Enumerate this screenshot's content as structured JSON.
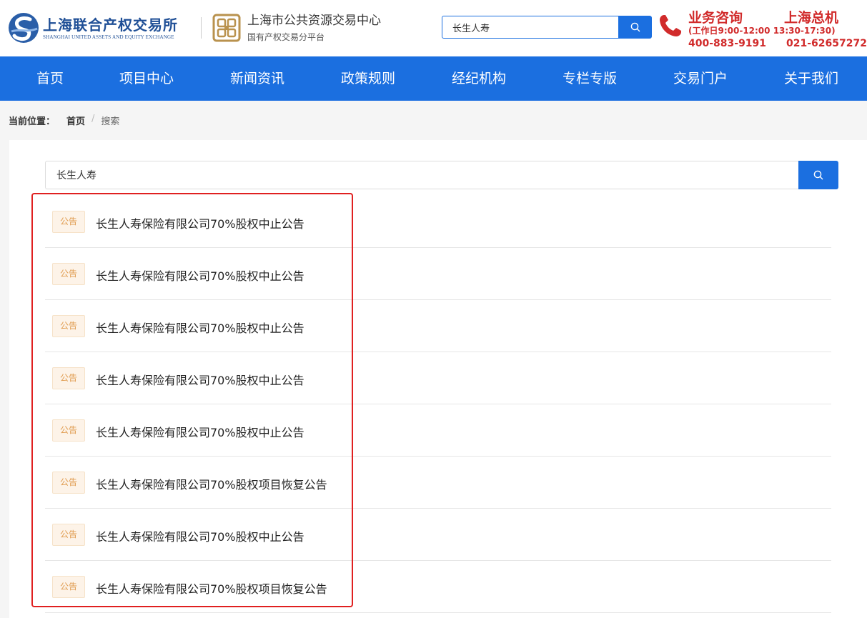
{
  "header": {
    "logo1": {
      "cn": "上海联合产权交易所",
      "en": "SHANGHAI UNITED ASSETS AND EQUITY EXCHANGE"
    },
    "logo2": {
      "cn": "上海市公共资源交易中心",
      "sub": "国有产权交易分平台"
    },
    "search": {
      "value": "长生人寿",
      "icon": "search-icon"
    },
    "contact": {
      "title1": "业务咨询",
      "title2": "上海总机",
      "hours": "(工作日9:00-12:00 13:30-17:30)",
      "phone1": "400-883-9191",
      "phone2": "021-62657272",
      "icon": "phone-icon"
    }
  },
  "nav": {
    "items": [
      {
        "label": "首页"
      },
      {
        "label": "项目中心"
      },
      {
        "label": "新闻资讯"
      },
      {
        "label": "政策规则"
      },
      {
        "label": "经纪机构"
      },
      {
        "label": "专栏专版"
      },
      {
        "label": "交易门户"
      },
      {
        "label": "关于我们"
      }
    ]
  },
  "breadcrumb": {
    "label": "当前位置：",
    "home": "首页",
    "separator": "/",
    "current": "搜索"
  },
  "main": {
    "search": {
      "value": "长生人寿"
    },
    "results": [
      {
        "badge": "公告",
        "title": "长生人寿保险有限公司70%股权中止公告"
      },
      {
        "badge": "公告",
        "title": "长生人寿保险有限公司70%股权中止公告"
      },
      {
        "badge": "公告",
        "title": "长生人寿保险有限公司70%股权中止公告"
      },
      {
        "badge": "公告",
        "title": "长生人寿保险有限公司70%股权中止公告"
      },
      {
        "badge": "公告",
        "title": "长生人寿保险有限公司70%股权中止公告"
      },
      {
        "badge": "公告",
        "title": "长生人寿保险有限公司70%股权项目恢复公告"
      },
      {
        "badge": "公告",
        "title": "长生人寿保险有限公司70%股权中止公告"
      },
      {
        "badge": "公告",
        "title": "长生人寿保险有限公司70%股权项目恢复公告"
      }
    ]
  },
  "colors": {
    "primary": "#1b6fe0",
    "contact_red": "#d12b2b",
    "badge_text": "#e09b4e",
    "badge_bg": "#fdf3e8",
    "highlight": "#e02020"
  }
}
